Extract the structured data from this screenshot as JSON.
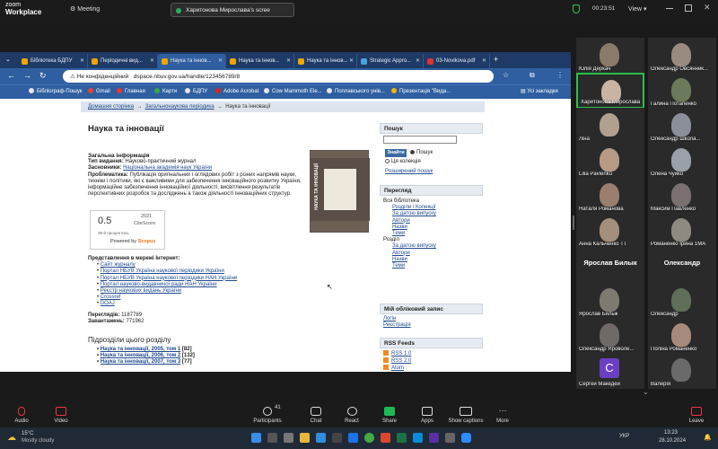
{
  "zoom": {
    "logo_line1": "zoom",
    "logo_line2": "Workplace",
    "meeting_label": "Meeting",
    "share_banner": "Харитонова Мирослава's scree",
    "timer": "00:23:51",
    "view_label": "View",
    "toolbar": [
      {
        "label": "Audio",
        "icon": "mic-off-icon"
      },
      {
        "label": "Video",
        "icon": "video-off-icon"
      },
      {
        "label": "Participants",
        "icon": "participants-icon",
        "count": "41"
      },
      {
        "label": "Chat",
        "icon": "chat-icon"
      },
      {
        "label": "React",
        "icon": "react-icon"
      },
      {
        "label": "Share",
        "icon": "share-icon"
      },
      {
        "label": "Apps",
        "icon": "apps-icon"
      },
      {
        "label": "Show captions",
        "icon": "captions-icon"
      },
      {
        "label": "More",
        "icon": "more-icon"
      },
      {
        "label": "Leave",
        "icon": "leave-icon"
      }
    ],
    "participants": [
      {
        "name": "Юлія Деркач",
        "color": "#8a7a6a"
      },
      {
        "name": "Олександр Овсянник...",
        "color": "#9a8a80"
      },
      {
        "name": "Харитонова Мирослава",
        "color": "#c9b3a2",
        "speaking": true
      },
      {
        "name": "Галина Потапенко",
        "color": "#6a7a5a"
      },
      {
        "name": "Ліна",
        "color": "#b0a090"
      },
      {
        "name": "Олександр Школа...",
        "color": "#8a8f9a"
      },
      {
        "name": "Lilia Pavlenko",
        "color": "#b69a86"
      },
      {
        "name": "Олена Чуйко",
        "color": "#9aa0a8"
      },
      {
        "name": "Наталя Романова",
        "color": "#9a7f6e"
      },
      {
        "name": "Максим Павленко",
        "color": "#7a7070"
      },
      {
        "name": "Анна Кальченко ТТ",
        "color": "#a38f7c"
      },
      {
        "name": "Романенко Ірина 1MA",
        "color": "#8e8a82"
      },
      {
        "name": "Ярослав Билык",
        "big": "Ярослав Билык"
      },
      {
        "name": "Олександр",
        "big": "Олександр"
      },
      {
        "name": "Ярослав Билык",
        "color": "#7f7a70"
      },
      {
        "name": "Олександр",
        "color": "#5f6f5a"
      },
      {
        "name": "Олександр Яроволе...",
        "color": "#6f6a68"
      },
      {
        "name": "Поліна Романенко",
        "color": "#a88a7a"
      },
      {
        "name": "Сергей Македей",
        "letter": "C"
      },
      {
        "name": "Валерія",
        "color": "#6a6a6a"
      }
    ]
  },
  "browser": {
    "tabs": [
      {
        "label": "Бібліотека БДПУ",
        "active": false
      },
      {
        "label": "Періодичні вид...",
        "active": false
      },
      {
        "label": "Наука та іннов...",
        "active": true
      },
      {
        "label": "Наука та іннов...",
        "active": false
      },
      {
        "label": "Наука та іннов...",
        "active": false
      },
      {
        "label": "Strategic Appro...",
        "active": false
      },
      {
        "label": "03-Novikova.pdf",
        "active": false
      }
    ],
    "security_label": "Не конфіденційний",
    "url": "dspace.nbuv.gov.ua/handle/123456789/8",
    "bookmarks": [
      "Бібліограф-Пошук",
      "Gmail",
      "Главная",
      "Карти",
      "БДПУ",
      "Adobe Acrobat",
      "Cow Mammoth Ele...",
      "Поплавського унів...",
      "Презентація \"Вида...",
      "Усі закладки"
    ]
  },
  "page": {
    "breadcrumb": [
      "Домашня сторінка",
      "Загальнонаукова періодика",
      "Наука та інновації"
    ],
    "title": "Наука та інновації",
    "general_heading": "Загальна інформація",
    "type_label": "Тип видання:",
    "type_value": "Науково-практичний журнал",
    "founders_label": "Засновники:",
    "founders_value": "Національна академія наук України",
    "problems_label": "Проблематика:",
    "problems_value": "Публікація оригінальних і оглядових робіт з різних напрямів науки, техніки і політики, які є важливими для забезпечення інноваційного розвитку України, інформаційне забезпечення інноваційної діяльності, висвітлення результатів перспективних розробок та досліджень а також діяльності інноваційних структур.",
    "cover_text": "НАУКА ТА ІННОВАЦІЇ",
    "citescore": {
      "value": "0.5",
      "year": "2021",
      "label": "CiteScore",
      "percentile": "39-й процентиль",
      "powered": "Powered by",
      "brand": "Scopus"
    },
    "internet_heading": "Представлення в мережі Інтернет:",
    "internet_links": [
      "Сайт журналу",
      "Портал НБУВ Україна наукової періодики України",
      "Портал НБУВ Україна наукової періодики НАН України",
      "Портал науково-видавничої ради НАН України",
      "Реєстр наукових видань України",
      "Crossref",
      "DOAJ"
    ],
    "views_label": "Переглядів:",
    "views_value": "1187789",
    "downloads_label": "Завантажень:",
    "downloads_value": "771962",
    "subsections_heading": "Підрозділи цього розділу",
    "subsections": [
      {
        "label": "Наука та інновації, 2005, том 1",
        "count": "[82]"
      },
      {
        "label": "Наука та інновації, 2006, том 2",
        "count": "[132]"
      },
      {
        "label": "Наука та інновації, 2007, том 3",
        "count": "[77]"
      }
    ]
  },
  "sidebar": {
    "search_heading": "Пошук",
    "go_label": "Знайти",
    "radio_search": "Пошук",
    "radio_collection": "Ця колекція",
    "advanced_search": "Розширений пошук",
    "browse_heading": "Перегляд",
    "all_library": "Вся бібліотека",
    "all_links": [
      "Розділи і Колекції",
      "За датою випуску",
      "Автори",
      "Назви",
      "Теми"
    ],
    "section_label": "Розділ",
    "section_links": [
      "За датою випуску",
      "Автори",
      "Назви",
      "Теми"
    ],
    "account_heading": "Мій обліковий запис",
    "account_links": [
      "Логін",
      "Реєстрація"
    ],
    "rss_heading": "RSS Feeds",
    "rss_links": [
      "RSS 1.0",
      "RSS 2.0",
      "Atom"
    ]
  },
  "taskbar": {
    "weather_temp": "15°C",
    "weather_desc": "Mostly cloudy",
    "lang": "УКР",
    "time": "13:23",
    "date": "28.10.2024"
  }
}
